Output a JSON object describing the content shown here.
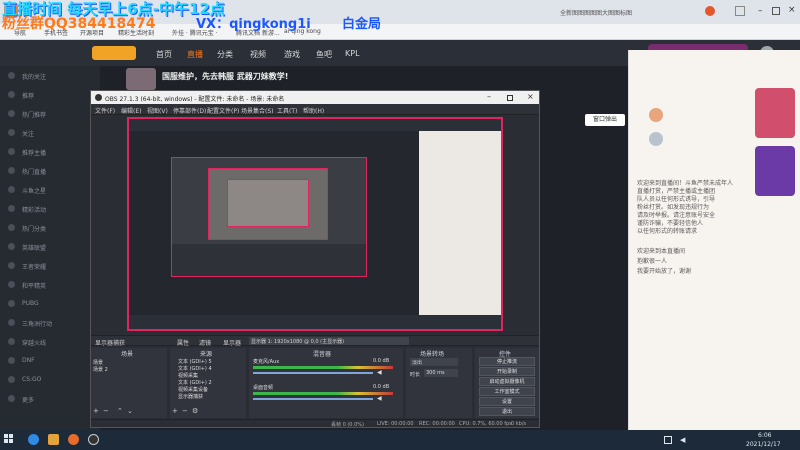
{
  "overlay": {
    "line1": "直播时间 每天早上6点-中午12点",
    "line2_left": "粉丝群QQ384418474",
    "line2_wx": "VX：qingkong1i",
    "line2_right": "白金局"
  },
  "browser": {
    "tab_title": "...",
    "address": "https://www.douyu.com/...",
    "site_text": "斗鱼",
    "bookmarks": [
      "导航",
      "手机书签",
      "开源项目",
      "精彩生活时刻",
      "外挂 · 腾讯元宝 ·",
      "腾讯文档",
      "新游...",
      "ai qing kong"
    ],
    "right_note": "全新图图图图图大图图标图"
  },
  "site": {
    "nav": [
      "首页",
      "直播",
      "分类",
      "视频",
      "游戏",
      "鱼吧",
      "KPL"
    ],
    "stream_title": "国服维护，先去韩服 武器刀妹教学!",
    "window_label": "窗口弹出",
    "sidebar": [
      "我的关注",
      "推荐",
      "热门推荐",
      "关注",
      "推荐主播",
      "热门直播",
      "斗鱼之星",
      "精彩活动",
      "热门分类",
      "英雄联盟",
      "王者荣耀",
      "和平精英",
      "PUBG",
      "三角洲行动",
      "穿越火线",
      "DNF",
      "CS:GO",
      "更多"
    ],
    "chat_lines": [
      "欢迎来到直播间！斗鱼严禁未成年人",
      "直播打赏，严禁主播或主播团",
      "队人员以任何形式诱导，引导",
      "粉丝打赏。如发现违规行为",
      "请及时举报。请注意账号安全",
      "谨防诈骗，不要轻信他人",
      "以任何形式的转账请求",
      "欢迎来到本直播间",
      "抱歉很一人",
      "我要开始放了，谢谢"
    ]
  },
  "obs": {
    "title": "OBS 27.1.3 (64-bit, windows) - 配置文件: 未命名 - 场景: 未命名",
    "menu": [
      "文件(F)",
      "编辑(E)",
      "视图(V)",
      "停靠部件(D)",
      "配置文件(P)",
      "场景集合(S)",
      "工具(T)",
      "帮助(H)"
    ],
    "toolbar": [
      "属性",
      "滤镜",
      "显示器",
      "显示器 1: 1920x1080 @ 0,0 (主显示器)"
    ],
    "scene_label": "显示器捕获",
    "docks": {
      "scenes": "场景",
      "sources": "来源",
      "mixer": "混音器",
      "transitions": "场景转场",
      "controls": "控件"
    },
    "scenes": [
      "场景",
      "场景 2"
    ],
    "sources": [
      "文本 (GDI+) 5",
      "文本 (GDI+) 4",
      "视频采集",
      "文本 (GDI+) 2",
      "视频采集设备",
      "显示器捕获"
    ],
    "mixer_tracks": [
      {
        "name": "麦克风/Aux",
        "level": "0.0 dB"
      },
      {
        "name": "桌面音频",
        "level": "0.0 dB"
      }
    ],
    "transition": {
      "type": "淡出",
      "duration_label": "时长",
      "duration": "300 ms"
    },
    "controls": [
      "停止推流",
      "开始录制",
      "启动虚拟摄像机",
      "工作室模式",
      "设置",
      "退出"
    ],
    "status": {
      "live": "LIVE: 00:00:00",
      "rec": "REC: 00:00:00",
      "cpu": "CPU: 0.7%, 60.00 fps",
      "drop": "丢帧 0 (0.0%)",
      "kbps": "0 kb/s"
    }
  },
  "taskbar": {
    "time": "6:06",
    "date": "2021/12/17"
  },
  "colors": {
    "accent_red": "#e0245e",
    "overlay_orange": "#ff7a1a",
    "overlay_cyan": "#28d7ff",
    "overlay_blue": "#1c58ff"
  }
}
